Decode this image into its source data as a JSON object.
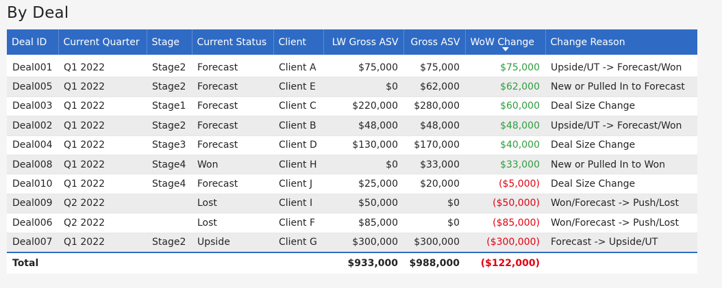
{
  "title": "By Deal",
  "colors": {
    "header_bg": "#2f6bc4",
    "positive": "#2e9e3e",
    "negative": "#e3000f"
  },
  "columns": [
    {
      "key": "deal_id",
      "label": "Deal ID"
    },
    {
      "key": "quarter",
      "label": "Current Quarter"
    },
    {
      "key": "stage",
      "label": "Stage"
    },
    {
      "key": "status",
      "label": "Current Status"
    },
    {
      "key": "client",
      "label": "Client"
    },
    {
      "key": "lw_asv",
      "label": "LW Gross ASV"
    },
    {
      "key": "asv",
      "label": "Gross ASV"
    },
    {
      "key": "wow",
      "label": "WoW Change"
    },
    {
      "key": "reason",
      "label": "Change Reason"
    }
  ],
  "sorted_column": "wow",
  "sort_direction": "descending",
  "rows": [
    {
      "deal_id": "Deal001",
      "quarter": "Q1 2022",
      "stage": "Stage2",
      "status": "Forecast",
      "client": "Client A",
      "lw_asv": "$75,000",
      "asv": "$75,000",
      "wow": "$75,000",
      "wow_sign": "pos",
      "reason": "Upside/UT -> Forecast/Won"
    },
    {
      "deal_id": "Deal005",
      "quarter": "Q1 2022",
      "stage": "Stage2",
      "status": "Forecast",
      "client": "Client E",
      "lw_asv": "$0",
      "asv": "$62,000",
      "wow": "$62,000",
      "wow_sign": "pos",
      "reason": "New or Pulled In to Forecast"
    },
    {
      "deal_id": "Deal003",
      "quarter": "Q1 2022",
      "stage": "Stage1",
      "status": "Forecast",
      "client": "Client C",
      "lw_asv": "$220,000",
      "asv": "$280,000",
      "wow": "$60,000",
      "wow_sign": "pos",
      "reason": "Deal Size Change"
    },
    {
      "deal_id": "Deal002",
      "quarter": "Q1 2022",
      "stage": "Stage2",
      "status": "Forecast",
      "client": "Client B",
      "lw_asv": "$48,000",
      "asv": "$48,000",
      "wow": "$48,000",
      "wow_sign": "pos",
      "reason": "Upside/UT -> Forecast/Won"
    },
    {
      "deal_id": "Deal004",
      "quarter": "Q1 2022",
      "stage": "Stage3",
      "status": "Forecast",
      "client": "Client D",
      "lw_asv": "$130,000",
      "asv": "$170,000",
      "wow": "$40,000",
      "wow_sign": "pos",
      "reason": "Deal Size Change"
    },
    {
      "deal_id": "Deal008",
      "quarter": "Q1 2022",
      "stage": "Stage4",
      "status": "Won",
      "client": "Client H",
      "lw_asv": "$0",
      "asv": "$33,000",
      "wow": "$33,000",
      "wow_sign": "pos",
      "reason": "New or Pulled In to Won"
    },
    {
      "deal_id": "Deal010",
      "quarter": "Q1 2022",
      "stage": "Stage4",
      "status": "Forecast",
      "client": "Client J",
      "lw_asv": "$25,000",
      "asv": "$20,000",
      "wow": "($5,000)",
      "wow_sign": "neg",
      "reason": "Deal Size Change"
    },
    {
      "deal_id": "Deal009",
      "quarter": "Q2 2022",
      "stage": "",
      "status": "Lost",
      "client": "Client I",
      "lw_asv": "$50,000",
      "asv": "$0",
      "wow": "($50,000)",
      "wow_sign": "neg",
      "reason": "Won/Forecast -> Push/Lost"
    },
    {
      "deal_id": "Deal006",
      "quarter": "Q2 2022",
      "stage": "",
      "status": "Lost",
      "client": "Client F",
      "lw_asv": "$85,000",
      "asv": "$0",
      "wow": "($85,000)",
      "wow_sign": "neg",
      "reason": "Won/Forecast -> Push/Lost"
    },
    {
      "deal_id": "Deal007",
      "quarter": "Q1 2022",
      "stage": "Stage2",
      "status": "Upside",
      "client": "Client G",
      "lw_asv": "$300,000",
      "asv": "$300,000",
      "wow": "($300,000)",
      "wow_sign": "neg",
      "reason": "Forecast -> Upside/UT"
    }
  ],
  "total": {
    "label": "Total",
    "lw_asv": "$933,000",
    "asv": "$988,000",
    "wow": "($122,000)",
    "wow_sign": "neg"
  }
}
